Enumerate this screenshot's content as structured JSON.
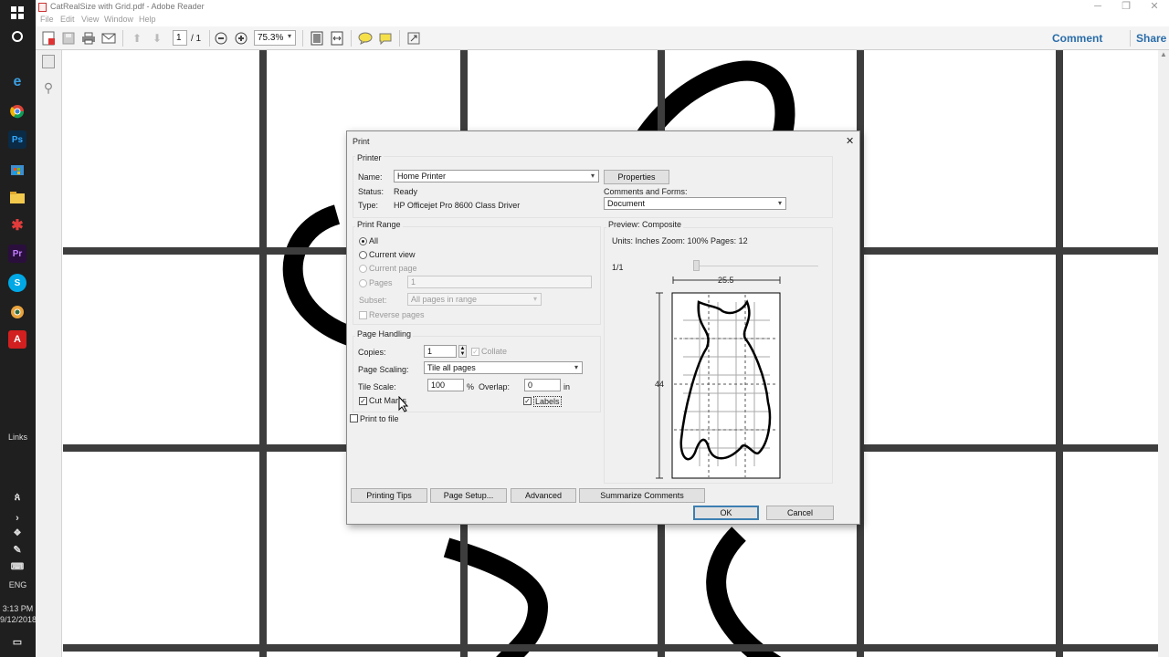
{
  "window": {
    "title": "CatRealSize with Grid.pdf - Adobe Reader",
    "minimize": "─",
    "restore": "❐",
    "close": "✕"
  },
  "menu": [
    "File",
    "Edit",
    "View",
    "Window",
    "Help"
  ],
  "toolbar": {
    "page_current": "1",
    "page_total": "/ 1",
    "zoom": "75.3%",
    "comment": "Comment",
    "share": "Share"
  },
  "taskbar": {
    "links": "Links",
    "lang": "ENG",
    "time": "3:13 PM",
    "date": "9/12/2018"
  },
  "dialog": {
    "title": "Print",
    "close": "✕",
    "printer": {
      "group": "Printer",
      "name_label": "Name:",
      "name_value": "Home Printer",
      "properties": "Properties",
      "status_label": "Status:",
      "status_value": "Ready",
      "type_label": "Type:",
      "type_value": "HP Officejet Pro 8600 Class Driver",
      "comments_label": "Comments and Forms:",
      "comments_value": "Document"
    },
    "range": {
      "group": "Print Range",
      "all": "All",
      "current_view": "Current view",
      "current_page": "Current page",
      "pages": "Pages",
      "pages_value": "1",
      "subset_label": "Subset:",
      "subset_value": "All pages in range",
      "reverse": "Reverse pages"
    },
    "handling": {
      "group": "Page Handling",
      "copies_label": "Copies:",
      "copies_value": "1",
      "collate": "Collate",
      "scaling_label": "Page Scaling:",
      "scaling_value": "Tile all pages",
      "tile_label": "Tile Scale:",
      "tile_value": "100",
      "pct": "%",
      "overlap_label": "Overlap:",
      "overlap_value": "0",
      "unit": "in",
      "cut_marks": "Cut Marks",
      "labels": "Labels"
    },
    "print_to_file": "Print to file",
    "preview": {
      "title": "Preview: Composite",
      "info": "Units: Inches Zoom: 100% Pages: 12",
      "page": "1/1",
      "width": "25.5",
      "height": "44"
    },
    "buttons": {
      "tips": "Printing Tips",
      "setup": "Page Setup...",
      "advanced": "Advanced",
      "summarize": "Summarize Comments",
      "ok": "OK",
      "cancel": "Cancel"
    }
  }
}
